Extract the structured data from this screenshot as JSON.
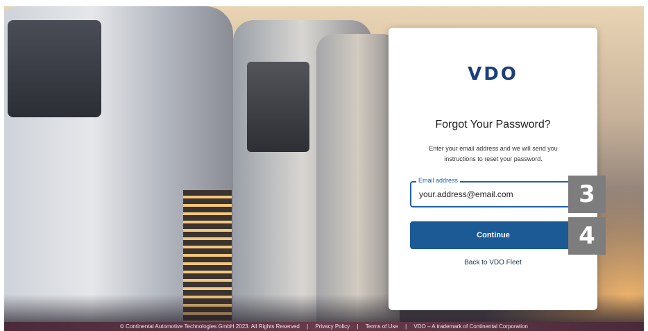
{
  "brand": {
    "logo_text": "VDO"
  },
  "form": {
    "title": "Forgot Your Password?",
    "description": "Enter your email address and we will send you instructions to reset your password.",
    "email_label": "Email address",
    "email_value": "your.address@email.com",
    "continue_label": "Continue",
    "back_link": "Back to VDO Fleet"
  },
  "annotations": {
    "step_3": "3",
    "step_4": "4"
  },
  "footer": {
    "copyright": "© Continental Automotive Technologies GmbH 2023. All Rights Reserved",
    "sep1": "|",
    "privacy": "Privacy Policy",
    "sep2": "|",
    "terms": "Terms of Use",
    "sep3": "|",
    "trademark": "VDO – A trademark of Continental Corporation"
  },
  "colors": {
    "primary": "#1c5a96",
    "logo": "#1c3f7a",
    "field_border": "#1f5fa8",
    "step_badge": "#7d7d7d"
  }
}
